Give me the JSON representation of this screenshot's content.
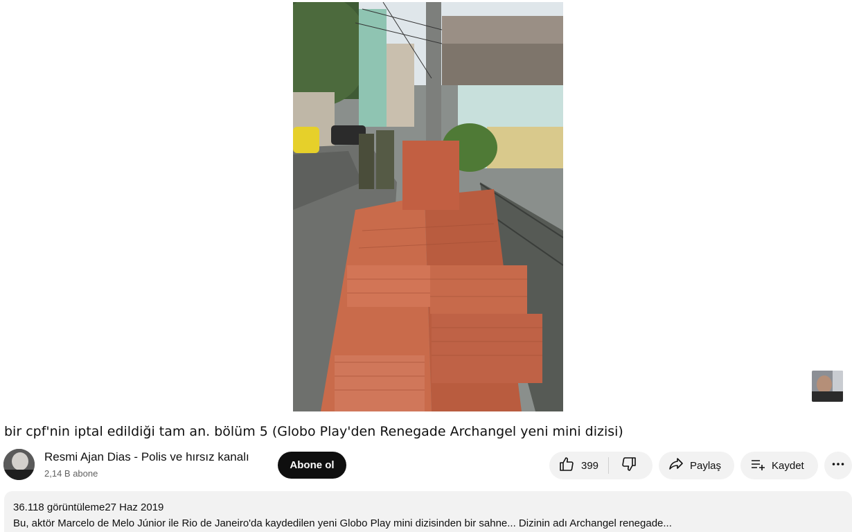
{
  "video": {
    "title": "bir cpf'nin iptal edildiği tam an. bölüm 5 (Globo Play'den Renegade Archangel yeni mini dizisi)"
  },
  "channel": {
    "name": "Resmi Ajan Dias - Polis ve hırsız kanalı",
    "subscribers": "2,14 B abone",
    "subscribe_label": "Abone ol"
  },
  "actions": {
    "like_count": "399",
    "share_label": "Paylaş",
    "save_label": "Kaydet"
  },
  "description": {
    "views": "36.118 görüntüleme",
    "date": "27 Haz 2019",
    "text": "Bu, aktör Marcelo de Melo Júnior ile Rio de Janeiro'da kaydedilen yeni Globo Play mini dizisinden bir sahne... Dizinin adı Archangel renegade..."
  },
  "icons": [
    "like-icon",
    "dislike-icon",
    "share-icon",
    "save-playlist-icon",
    "more-icon"
  ]
}
